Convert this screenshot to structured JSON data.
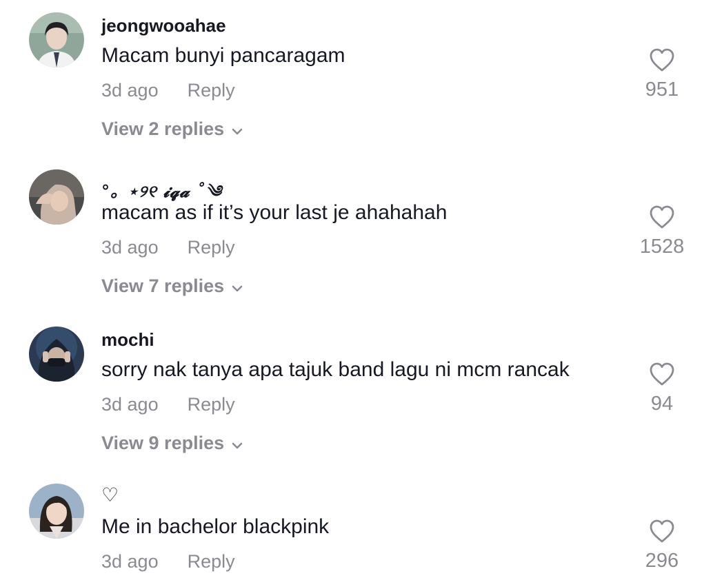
{
  "comments": [
    {
      "username": "jeongwooahae",
      "text": "Macam bunyi pancaragam",
      "time": "3d ago",
      "reply_label": "Reply",
      "likes": "951",
      "view_replies": "View 2 replies"
    },
    {
      "username": "°。⋆୨୧ 𝓲𝓺𝓪 ˚༄",
      "text": "macam as if it’s your last je ahahahah",
      "time": "3d ago",
      "reply_label": "Reply",
      "likes": "1528",
      "view_replies": "View 7 replies"
    },
    {
      "username": "mochi",
      "text": "sorry nak tanya apa tajuk band lagu ni mcm rancak",
      "time": "3d ago",
      "reply_label": "Reply",
      "likes": "94",
      "view_replies": "View 9 replies"
    },
    {
      "username": "♡",
      "text": "Me in bachelor blackpink",
      "time": "3d ago",
      "reply_label": "Reply",
      "likes": "296"
    }
  ],
  "icons": {
    "like": "heart-outline-icon",
    "expand": "chevron-down-icon"
  },
  "colors": {
    "primary_text": "#161823",
    "secondary_text": "#8a8b91",
    "background": "#ffffff"
  }
}
